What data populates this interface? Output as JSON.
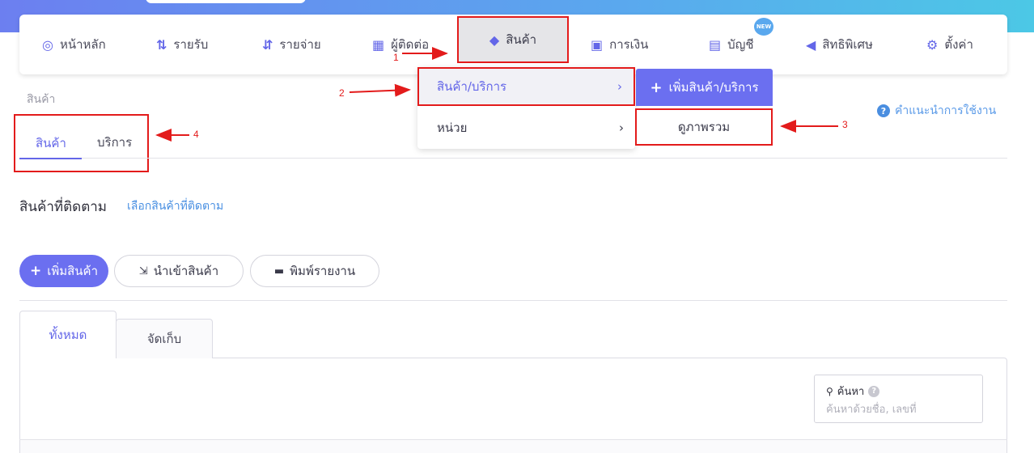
{
  "nav": {
    "items": [
      {
        "label": "หน้าหลัก",
        "icon": "gauge-icon"
      },
      {
        "label": "รายรับ",
        "icon": "income-icon"
      },
      {
        "label": "รายจ่าย",
        "icon": "expense-icon"
      },
      {
        "label": "ผู้ติดต่อ",
        "icon": "building-icon"
      },
      {
        "label": "สินค้า",
        "icon": "box-icon"
      },
      {
        "label": "การเงิน",
        "icon": "money-icon"
      },
      {
        "label": "บัญชี",
        "icon": "ledger-icon"
      },
      {
        "label": "สิทธิพิเศษ",
        "icon": "megaphone-icon"
      },
      {
        "label": "ตั้งค่า",
        "icon": "gear-icon"
      }
    ],
    "new_badge": "NEW"
  },
  "dropdown": {
    "items": [
      {
        "label": "สินค้า/บริการ"
      },
      {
        "label": "หน่วย"
      }
    ],
    "chevron": "›"
  },
  "submenu": {
    "add_label": "เพิ่มสินค้า/บริการ",
    "overview_label": "ดูภาพรวม"
  },
  "breadcrumb": "สินค้า",
  "help_label": "คำแนะนำการใช้งาน",
  "page_tabs": [
    "สินค้า",
    "บริการ"
  ],
  "followed": {
    "title": "สินค้าที่ติดตาม",
    "link": "เลือกสินค้าที่ติดตาม"
  },
  "actions": {
    "add_product": "เพิ่มสินค้า",
    "import_product": "นำเข้าสินค้า",
    "print_report": "พิมพ์รายงาน"
  },
  "content_tabs": [
    "ทั้งหมด",
    "จัดเก็บ"
  ],
  "search": {
    "label": "ค้นหา",
    "placeholder": "ค้นหาด้วยชื่อ, เลขที่"
  },
  "annotations": [
    "1",
    "2",
    "3",
    "4"
  ],
  "colors": {
    "accent": "#6b6ff0",
    "annotation": "#e31b1b",
    "link": "#4a90e2"
  }
}
